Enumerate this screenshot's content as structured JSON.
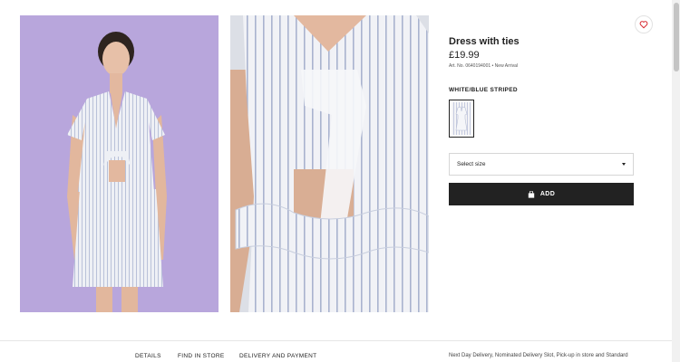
{
  "product": {
    "title": "Dress with ties",
    "price": "£19.99",
    "meta": "Art. No. 0640194001  •  New Arrival",
    "color_label": "WHITE/BLUE STRIPED"
  },
  "size_select": {
    "placeholder": "Select size"
  },
  "add_button": {
    "label": "ADD"
  },
  "tabs": {
    "details": "DETAILS",
    "find_in_store": "FIND IN STORE",
    "delivery": "DELIVERY AND PAYMENT"
  },
  "delivery_info": "Next Day Delivery, Nominated Delivery Slot, Pick-up in store and Standard",
  "colors": {
    "lavender_background": "#b8a6dc",
    "button_black": "#222222",
    "heart_red": "#d6232a"
  },
  "icons": {
    "favourite": "heart-icon",
    "bag": "bag-icon",
    "dropdown": "chevron-down-icon"
  }
}
